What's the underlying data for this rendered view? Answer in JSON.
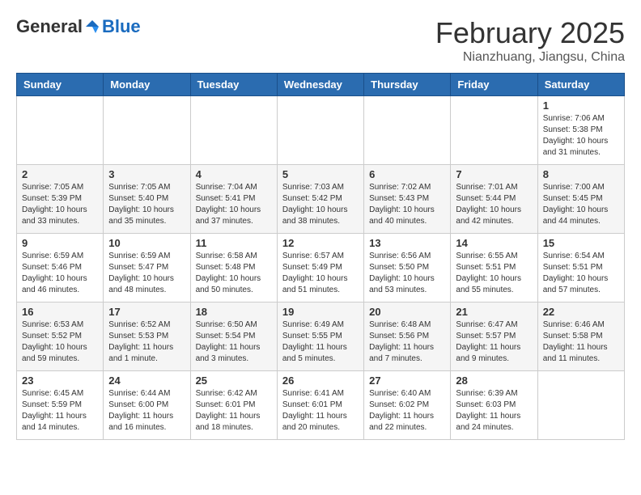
{
  "header": {
    "logo_general": "General",
    "logo_blue": "Blue",
    "month_title": "February 2025",
    "subtitle": "Nianzhuang, Jiangsu, China"
  },
  "weekdays": [
    "Sunday",
    "Monday",
    "Tuesday",
    "Wednesday",
    "Thursday",
    "Friday",
    "Saturday"
  ],
  "weeks": [
    [
      {
        "day": "",
        "info": ""
      },
      {
        "day": "",
        "info": ""
      },
      {
        "day": "",
        "info": ""
      },
      {
        "day": "",
        "info": ""
      },
      {
        "day": "",
        "info": ""
      },
      {
        "day": "",
        "info": ""
      },
      {
        "day": "1",
        "info": "Sunrise: 7:06 AM\nSunset: 5:38 PM\nDaylight: 10 hours\nand 31 minutes."
      }
    ],
    [
      {
        "day": "2",
        "info": "Sunrise: 7:05 AM\nSunset: 5:39 PM\nDaylight: 10 hours\nand 33 minutes."
      },
      {
        "day": "3",
        "info": "Sunrise: 7:05 AM\nSunset: 5:40 PM\nDaylight: 10 hours\nand 35 minutes."
      },
      {
        "day": "4",
        "info": "Sunrise: 7:04 AM\nSunset: 5:41 PM\nDaylight: 10 hours\nand 37 minutes."
      },
      {
        "day": "5",
        "info": "Sunrise: 7:03 AM\nSunset: 5:42 PM\nDaylight: 10 hours\nand 38 minutes."
      },
      {
        "day": "6",
        "info": "Sunrise: 7:02 AM\nSunset: 5:43 PM\nDaylight: 10 hours\nand 40 minutes."
      },
      {
        "day": "7",
        "info": "Sunrise: 7:01 AM\nSunset: 5:44 PM\nDaylight: 10 hours\nand 42 minutes."
      },
      {
        "day": "8",
        "info": "Sunrise: 7:00 AM\nSunset: 5:45 PM\nDaylight: 10 hours\nand 44 minutes."
      }
    ],
    [
      {
        "day": "9",
        "info": "Sunrise: 6:59 AM\nSunset: 5:46 PM\nDaylight: 10 hours\nand 46 minutes."
      },
      {
        "day": "10",
        "info": "Sunrise: 6:59 AM\nSunset: 5:47 PM\nDaylight: 10 hours\nand 48 minutes."
      },
      {
        "day": "11",
        "info": "Sunrise: 6:58 AM\nSunset: 5:48 PM\nDaylight: 10 hours\nand 50 minutes."
      },
      {
        "day": "12",
        "info": "Sunrise: 6:57 AM\nSunset: 5:49 PM\nDaylight: 10 hours\nand 51 minutes."
      },
      {
        "day": "13",
        "info": "Sunrise: 6:56 AM\nSunset: 5:50 PM\nDaylight: 10 hours\nand 53 minutes."
      },
      {
        "day": "14",
        "info": "Sunrise: 6:55 AM\nSunset: 5:51 PM\nDaylight: 10 hours\nand 55 minutes."
      },
      {
        "day": "15",
        "info": "Sunrise: 6:54 AM\nSunset: 5:51 PM\nDaylight: 10 hours\nand 57 minutes."
      }
    ],
    [
      {
        "day": "16",
        "info": "Sunrise: 6:53 AM\nSunset: 5:52 PM\nDaylight: 10 hours\nand 59 minutes."
      },
      {
        "day": "17",
        "info": "Sunrise: 6:52 AM\nSunset: 5:53 PM\nDaylight: 11 hours\nand 1 minute."
      },
      {
        "day": "18",
        "info": "Sunrise: 6:50 AM\nSunset: 5:54 PM\nDaylight: 11 hours\nand 3 minutes."
      },
      {
        "day": "19",
        "info": "Sunrise: 6:49 AM\nSunset: 5:55 PM\nDaylight: 11 hours\nand 5 minutes."
      },
      {
        "day": "20",
        "info": "Sunrise: 6:48 AM\nSunset: 5:56 PM\nDaylight: 11 hours\nand 7 minutes."
      },
      {
        "day": "21",
        "info": "Sunrise: 6:47 AM\nSunset: 5:57 PM\nDaylight: 11 hours\nand 9 minutes."
      },
      {
        "day": "22",
        "info": "Sunrise: 6:46 AM\nSunset: 5:58 PM\nDaylight: 11 hours\nand 11 minutes."
      }
    ],
    [
      {
        "day": "23",
        "info": "Sunrise: 6:45 AM\nSunset: 5:59 PM\nDaylight: 11 hours\nand 14 minutes."
      },
      {
        "day": "24",
        "info": "Sunrise: 6:44 AM\nSunset: 6:00 PM\nDaylight: 11 hours\nand 16 minutes."
      },
      {
        "day": "25",
        "info": "Sunrise: 6:42 AM\nSunset: 6:01 PM\nDaylight: 11 hours\nand 18 minutes."
      },
      {
        "day": "26",
        "info": "Sunrise: 6:41 AM\nSunset: 6:01 PM\nDaylight: 11 hours\nand 20 minutes."
      },
      {
        "day": "27",
        "info": "Sunrise: 6:40 AM\nSunset: 6:02 PM\nDaylight: 11 hours\nand 22 minutes."
      },
      {
        "day": "28",
        "info": "Sunrise: 6:39 AM\nSunset: 6:03 PM\nDaylight: 11 hours\nand 24 minutes."
      },
      {
        "day": "",
        "info": ""
      }
    ]
  ]
}
